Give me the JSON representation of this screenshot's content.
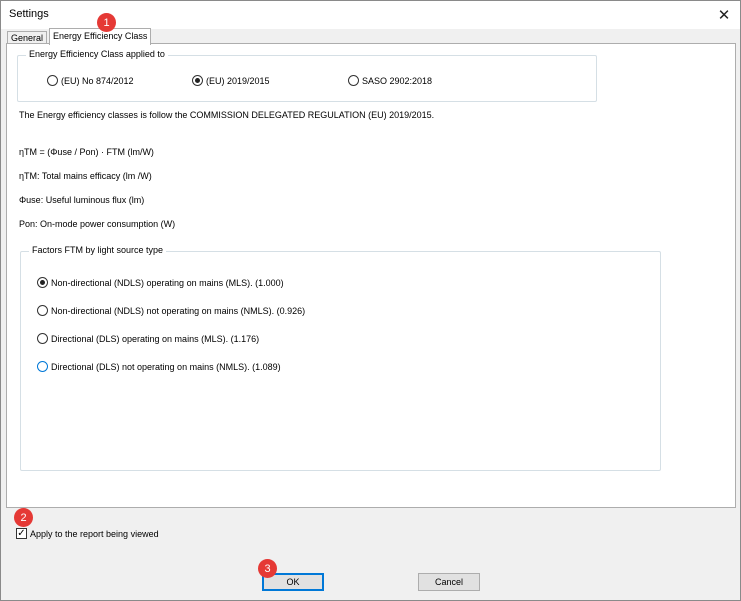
{
  "window": {
    "title": "Settings",
    "close_glyph": "✕"
  },
  "tabs": [
    {
      "label": "General",
      "active": false
    },
    {
      "label": "Energy Efficiency Class",
      "active": true
    }
  ],
  "efficiency_group": {
    "label": "Energy Efficiency Class applied to",
    "options": [
      {
        "label": "(EU) No 874/2012",
        "selected": false
      },
      {
        "label": "(EU) 2019/2015",
        "selected": true
      },
      {
        "label": "SASO 2902:2018",
        "selected": false
      }
    ]
  },
  "info": {
    "regulation": "The Energy efficiency classes is follow the COMMISSION DELEGATED REGULATION (EU) 2019/2015.",
    "formula": "ηTM = (Φuse / Pon) · FTM (lm/W)",
    "def_etm": "ηTM: Total mains efficacy (lm /W)",
    "def_phi": "Φuse: Useful luminous flux (lm)",
    "def_pon": "Pon: On-mode power consumption (W)"
  },
  "factors_group": {
    "label": "Factors FTM by light source type",
    "options": [
      {
        "label": "Non-directional (NDLS) operating on mains (MLS).  (1.000)",
        "selected": true
      },
      {
        "label": "Non-directional (NDLS) not operating on mains (NMLS).  (0.926)",
        "selected": false
      },
      {
        "label": "Directional (DLS) operating on mains (MLS).  (1.176)",
        "selected": false
      },
      {
        "label": "Directional (DLS) not operating on mains (NMLS).  (1.089)",
        "selected": false
      }
    ]
  },
  "apply_checkbox": {
    "label": "Apply to the report being viewed",
    "checked": true,
    "glyph": "✓"
  },
  "buttons": {
    "ok": "OK",
    "cancel": "Cancel"
  },
  "markers": [
    "1",
    "2",
    "3"
  ],
  "colors": {
    "marker": "#e53935",
    "focus": "#0078d7"
  }
}
